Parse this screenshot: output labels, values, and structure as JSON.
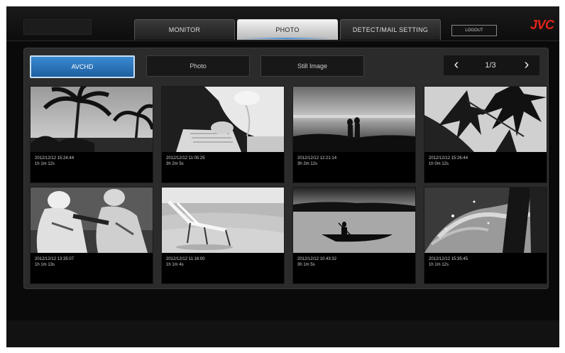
{
  "tabs": [
    {
      "label": "MONITOR",
      "active": false
    },
    {
      "label": "PHOTO",
      "active": true
    },
    {
      "label": "DETECT/MAIL SETTING",
      "active": false
    }
  ],
  "logout_label": "LOGOUT",
  "brand": "JVC",
  "filters": [
    {
      "label": "AVCHD",
      "active": true
    },
    {
      "label": "Photo",
      "active": false
    },
    {
      "label": "Still Image",
      "active": false
    }
  ],
  "pager": {
    "prev_icon": "chevron-left-icon",
    "next_icon": "chevron-right-icon",
    "text": "1/3"
  },
  "thumbnails": [
    {
      "scene": "palm-trees",
      "date": "2012/12/12 15:24:44",
      "duration": "1h 1m 12s"
    },
    {
      "scene": "reading-person",
      "date": "2012/12/12 11:05:25",
      "duration": "3h 2m 5s"
    },
    {
      "scene": "beach-couple",
      "date": "2012/12/12 12:21:14",
      "duration": "3h 2m 12s"
    },
    {
      "scene": "leaves",
      "date": "2012/12/12 15:26:44",
      "duration": "1h 0m 12s"
    },
    {
      "scene": "football-players",
      "date": "2012/12/12 13:35:07",
      "duration": "1h 1m 13s"
    },
    {
      "scene": "beach-chair",
      "date": "2012/12/12 11:16:00",
      "duration": "1h 1m 4s"
    },
    {
      "scene": "canoe-lake",
      "date": "2012/12/12 10:43:32",
      "duration": "3h 1m 5s"
    },
    {
      "scene": "water-splash",
      "date": "2012/12/12 15:35:45",
      "duration": "1h 1m 12s"
    }
  ],
  "colors": {
    "accent": "#2f7fcc",
    "brand": "#e2231a",
    "tab_underline": "#4a90d9"
  }
}
